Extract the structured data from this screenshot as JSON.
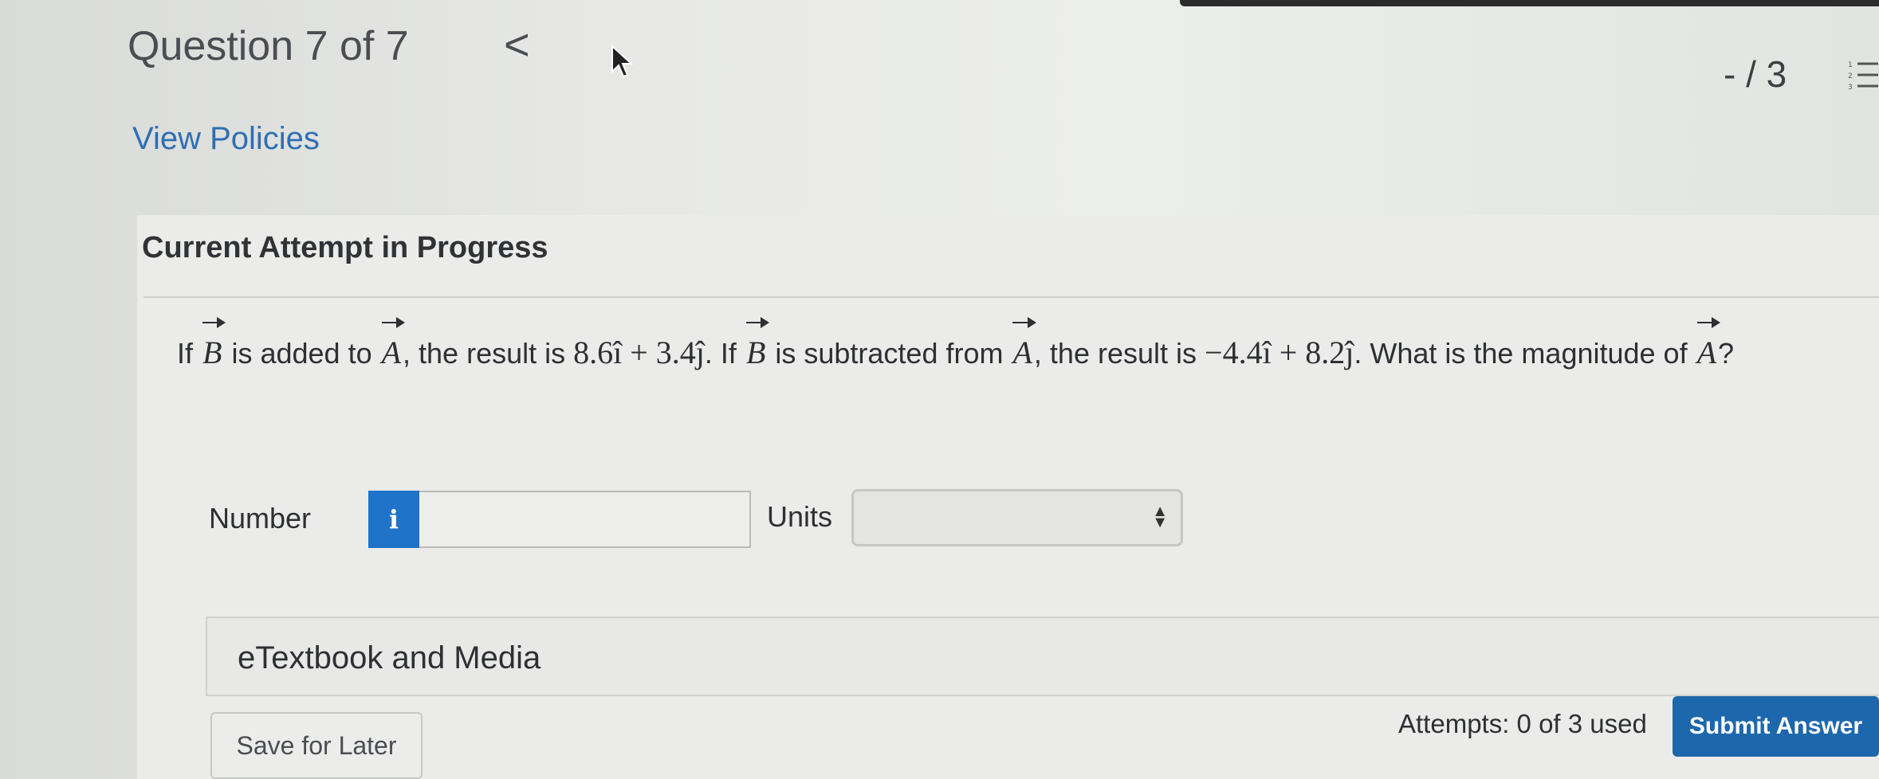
{
  "header": {
    "question_title": "Question 7 of 7",
    "prev_glyph": "<",
    "score": "- / 3"
  },
  "links": {
    "view_policies": "View Policies"
  },
  "attempt": {
    "title": "Current Attempt in Progress"
  },
  "question": {
    "t1": "If ",
    "vec_b": "B",
    "t2": " is added to ",
    "vec_a": "A",
    "t3": ", the result is ",
    "m1": "8.6î + 3.4ĵ",
    "t4": ". If ",
    "t5": " is subtracted from ",
    "t6": ", the result is ",
    "m2": "−4.4î + 8.2ĵ",
    "t7": ". What is the magnitude of ",
    "t8": "?"
  },
  "answer": {
    "number_label": "Number",
    "info_icon_glyph": "i",
    "number_value": "",
    "units_label": "Units",
    "units_value": ""
  },
  "etextbook": {
    "label": "eTextbook and Media"
  },
  "footer": {
    "save_label": "Save for Later",
    "attempts_text": "Attempts: 0 of 3 used",
    "submit_label": "Submit Answer"
  },
  "colors": {
    "link": "#2f6fb3",
    "primary_button": "#1d67ad",
    "info_button": "#1f73c9"
  },
  "icons": [
    "chevron-left-icon",
    "cursor-icon",
    "numbered-list-icon",
    "info-icon",
    "select-arrows-icon"
  ]
}
